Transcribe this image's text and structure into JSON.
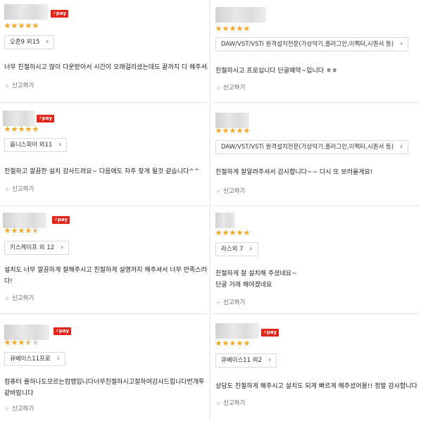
{
  "theme": {
    "star_color": "#f5a623",
    "pay_badge_color": "#e2231a",
    "divider_color": "#e6e6e6"
  },
  "pay_label": "pay",
  "report_label": "신고하기",
  "left": [
    {
      "rating": 5,
      "option": "오존9 외15",
      "text_lines": [
        "너무 친절하시고 많이 다운받아서 시간이 오래걸리셨는데도 끝까지 다 해주셔서"
      ]
    },
    {
      "rating": 5,
      "option": "옴니스피어 외11",
      "text_lines": [
        "친절하고 깔끔한 설치 감사드려요~ 다음에도 자주 찾게 될것 같습니다^^"
      ]
    },
    {
      "rating": 4.5,
      "option": "키스케이프 외 12",
      "text_lines": [
        "설치도 너무 깔끔하게 잘해주시고 친절하게 설명까지 해주셔서 너무 만족스러웠",
        "다!"
      ]
    },
    {
      "rating": 3.5,
      "option": "큐베이스11프로",
      "text_lines": [
        "컴퓨터 를하나도모르는컴맹입니다너무친절하시고잘하여감사드립니다번개투",
        "같바랍니다"
      ]
    }
  ],
  "right": [
    {
      "rating": 5,
      "option": "DAW/VST/VSTi 원격설치전문(가상악기,플러그인,이펙터,시퀀서 등)",
      "text_lines": [
        "친절하시고 프로십니다 단골예약~입니다 ㅎㅎ"
      ]
    },
    {
      "rating": 5,
      "option": "DAW/VST/VSTi 원격설치전문(가상악기,플러그인,이펙터,시퀀서 등)",
      "text_lines": [
        "친절하게 잘알려주셔서 감사합니다~~ 다시 또 보러올게요!"
      ]
    },
    {
      "rating": 5,
      "option": "라스외 7",
      "text_lines": [
        "친절하게 잘 설치해 주셨네요~",
        "단골 거래 해야겠네요"
      ]
    },
    {
      "rating": 5,
      "option": "큐베이스11 외2",
      "text_lines": [
        "상담도 친절하게 해주시고 설치도 되게 빠르게 해주셨어용!! 정말 감사합니다"
      ]
    }
  ]
}
